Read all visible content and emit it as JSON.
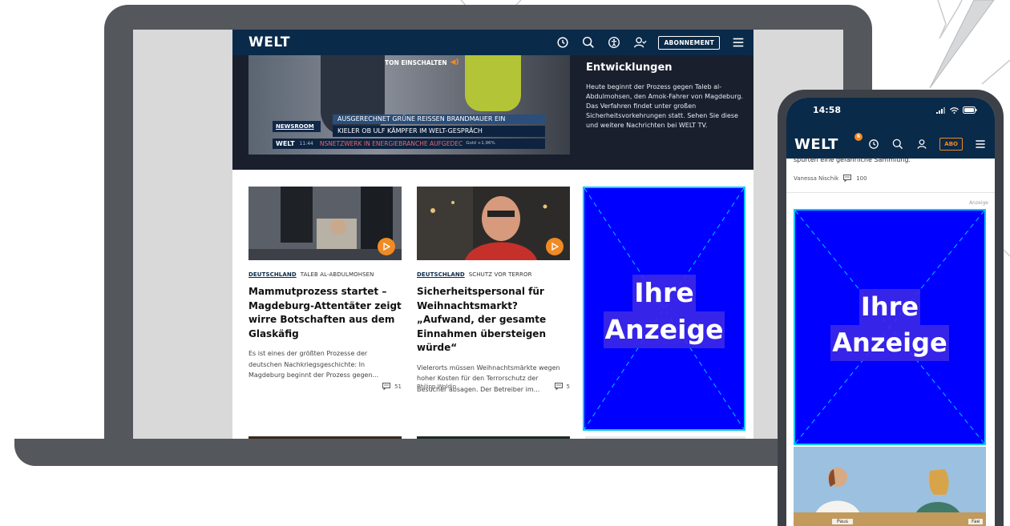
{
  "laptop": {
    "header": {
      "logo": "WELT",
      "abo_label": "ABONNEMENT"
    },
    "hero": {
      "sound_label": "TON EINSCHALTEN",
      "ticker_top": "AUSGERECHNET GRÜNE REISSEN BRANDMAUER EIN",
      "newsroom": "NEWSROOM",
      "ticker_mid": "KIELER OB ULF KÄMPFER IM WELT-GESPRÄCH",
      "ticker_logo": "WELT",
      "ticker_time": "11:44",
      "ticker_bottom": "NSNETZWERK IN ENERGIEBRANCHE AUFGEDEC",
      "ticker_gold": "Gold +1,96%",
      "title": "Entwicklungen",
      "description": "Heute beginnt der Prozess gegen Taleb al-Abdulmohsen, den Amok-Fahrer von Magdeburg. Das Verfahren findet unter großen Sicherheitsvorkehrungen statt. Sehen Sie diese und weitere Nachrichten bei WELT TV."
    },
    "cards": [
      {
        "kicker_section": "DEUTSCHLAND",
        "kicker_topic": "TALEB AL-ABDULMOHSEN",
        "title": "Mammutprozess startet – Magdeburg-Attentäter zeigt wirre Botschaften aus dem Glaskäfig",
        "description": "Es ist eines der größten Prozesse der deutschen Nachkriegsgeschichte: In Magdeburg beginnt der Prozess gegen...",
        "author": "",
        "comments": "51"
      },
      {
        "kicker_section": "DEUTSCHLAND",
        "kicker_topic": "SCHUTZ VOR TERROR",
        "title": "Sicherheitspersonal für Weihnachtsmarkt? „Aufwand, der gesamte Einnahmen übersteigen würde“",
        "description": "Vielerorts müssen Weihnachtsmärkte wegen hoher Kosten für den Terrorschutz der Besucher absagen. Der Betreiber im...",
        "author": "Philipp Woldin",
        "comments": "5"
      }
    ],
    "ad": {
      "line1": "Ihre",
      "line2": "Anzeige"
    }
  },
  "phone": {
    "status_time": "14:58",
    "header": {
      "logo": "WELT",
      "badge": "6",
      "abo_label": "ABO"
    },
    "cut_text": "spürten eine gefährliche Sammlung.",
    "byline_author": "Vanessa Nischik",
    "byline_comments": "100",
    "ad_label": "Anzeige",
    "ad": {
      "line1": "Ihre",
      "line2": "Anzeige"
    },
    "photo_label1": "Paus",
    "photo_label2": "Fae"
  },
  "colors": {
    "brand_navy": "#0a2a4a",
    "accent_orange": "#f08a24",
    "ad_blue": "#0000ff",
    "device_gray": "#54575c"
  }
}
